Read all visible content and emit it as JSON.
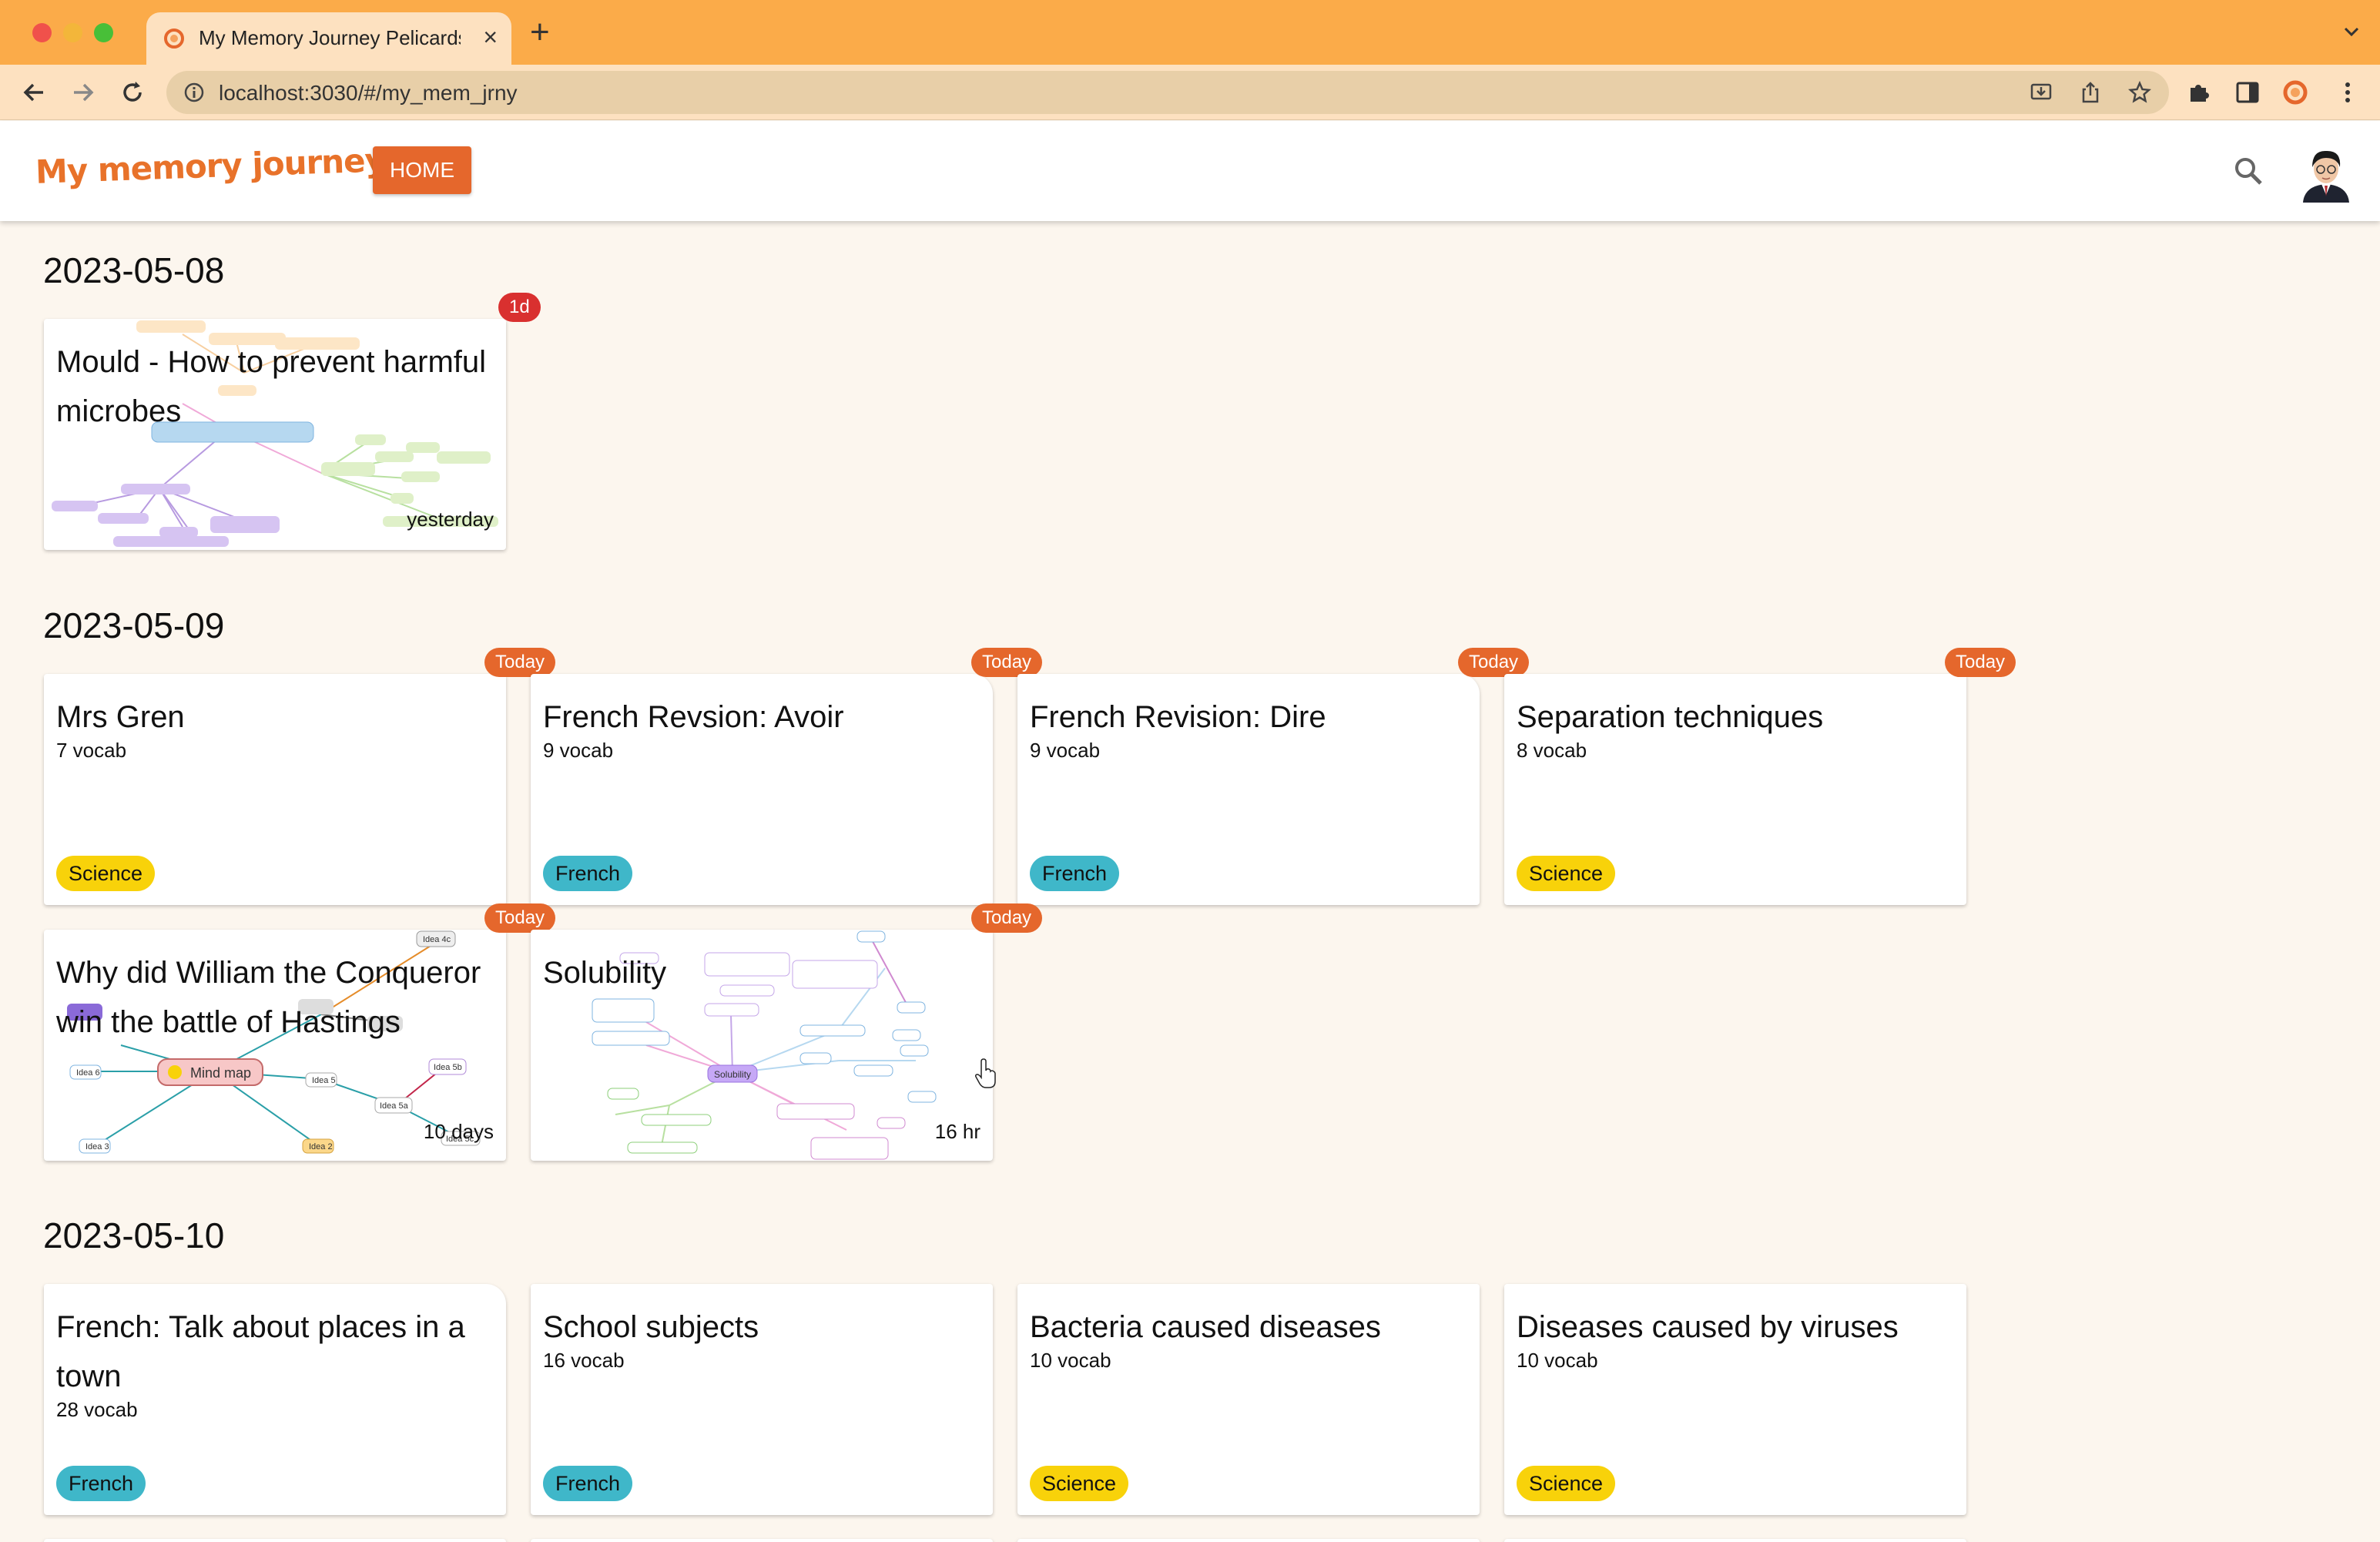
{
  "browser": {
    "tab_title": "My Memory Journey Pelicards",
    "url": "localhost:3030/#/my_mem_jrny",
    "colors": {
      "tabbar": "#fbab49",
      "toolbar": "#fde1c0"
    }
  },
  "app": {
    "logo": "My memory journey",
    "home_label": "HOME",
    "accent_color": "#e5672c",
    "search_icon": "search-icon",
    "avatar_icon": "user-avatar"
  },
  "groups": [
    {
      "date": "2023-05-08",
      "cards": [
        {
          "title": "Mould - How to prevent harmful microbes",
          "badge": "1d",
          "time": "yesterday",
          "type": "mindmap"
        }
      ]
    },
    {
      "date": "2023-05-09",
      "cards": [
        {
          "title": "Mrs Gren",
          "vocab": "7 vocab",
          "tag": "Science",
          "badge": "Today"
        },
        {
          "title": "French Revsion: Avoir",
          "vocab": "9 vocab",
          "tag": "French",
          "badge": "Today"
        },
        {
          "title": "French Revision: Dire",
          "vocab": "9 vocab",
          "tag": "French",
          "badge": "Today"
        },
        {
          "title": "Separation techniques",
          "vocab": "8 vocab",
          "tag": "Science",
          "badge": "Today"
        },
        {
          "title": "Why did William the Conqueror win the battle of Hastings",
          "badge": "Today",
          "time": "10 days",
          "type": "mindmap",
          "mindmap_labels": [
            "Mind map",
            "Idea 4c",
            "Idea 5",
            "Idea 5a",
            "Idea 5b",
            "Idea 6",
            "Idea 3",
            "Idea 2",
            "Idea 5c"
          ]
        },
        {
          "title": "Solubility",
          "badge": "Today",
          "time": "16 hr",
          "type": "mindmap",
          "mindmap_labels": [
            "Solubility"
          ]
        }
      ]
    },
    {
      "date": "2023-05-10",
      "cards": [
        {
          "title": "French: Talk about places in a town",
          "vocab": "28 vocab",
          "tag": "French"
        },
        {
          "title": "School subjects",
          "vocab": "16 vocab",
          "tag": "French"
        },
        {
          "title": "Bacteria caused diseases",
          "vocab": "10 vocab",
          "tag": "Science"
        },
        {
          "title": "Diseases caused by viruses",
          "vocab": "10 vocab",
          "tag": "Science"
        }
      ]
    }
  ],
  "tag_colors": {
    "Science": "#f8d20a",
    "French": "#3fb7c9"
  }
}
